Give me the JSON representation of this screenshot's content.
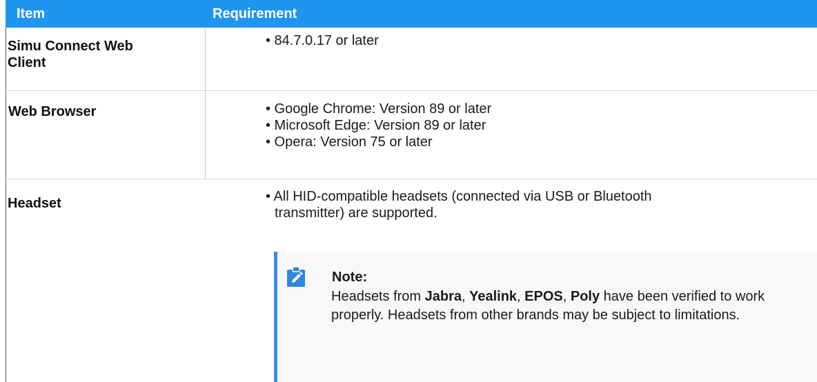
{
  "columns": {
    "item": "Item",
    "requirement": "Requirement"
  },
  "rows": [
    {
      "item": "Simu Connect Web Client",
      "requirements": [
        "• 84.7.0.17 or later"
      ]
    },
    {
      "item": "Web Browser",
      "requirements": [
        "• Google Chrome: Version 89 or later",
        "• Microsoft Edge: Version 89 or later",
        "• Opera: Version 75 or later"
      ]
    },
    {
      "item": "Headset",
      "requirements": [
        "• All HID-compatible headsets (connected via USB or Bluetooth",
        "transmitter) are supported."
      ]
    }
  ],
  "note": {
    "icon": "edit-note-icon",
    "title": "Note:",
    "body_prefix": "Headsets from ",
    "brand1": "Jabra",
    "sep1": ", ",
    "brand2": "Yealink",
    "sep2": ", ",
    "brand3": "EPOS",
    "sep3": ", ",
    "brand4": "Poly",
    "body_suffix": " have been verified to work properly. Headsets from other brands may be subject to limitations."
  },
  "colors": {
    "header_bg": "#1e96f0",
    "note_bar": "#3d8de3",
    "note_bg": "#f7f8fa"
  }
}
